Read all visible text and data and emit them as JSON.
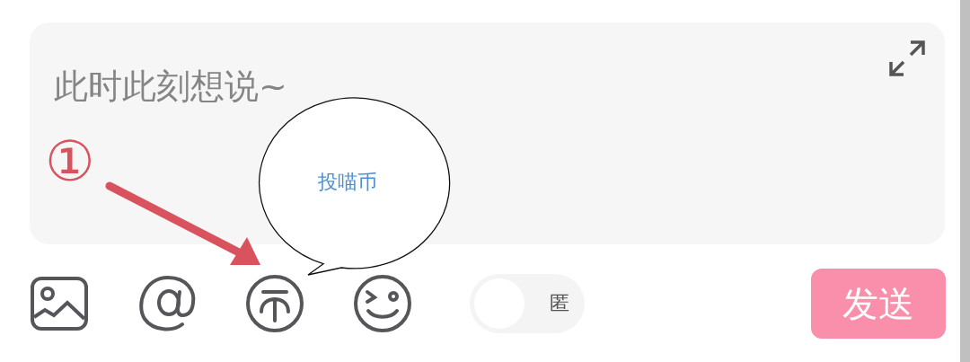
{
  "composer": {
    "placeholder": "此时此刻想说~"
  },
  "toolbar": [
    {
      "kind": "image"
    },
    {
      "kind": "mention"
    },
    {
      "kind": "coin"
    },
    {
      "kind": "emoji"
    }
  ],
  "anonymous_toggle": {
    "label": "匿",
    "on": false
  },
  "send_button": {
    "label": "发送"
  },
  "annotation": {
    "marker": "①",
    "callout": "投喵币"
  }
}
